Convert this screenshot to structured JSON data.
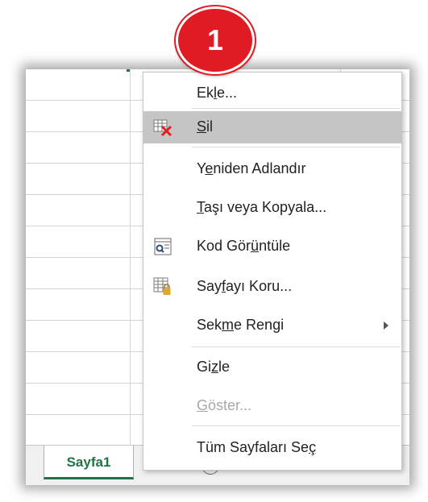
{
  "sheet_tab": {
    "label": "Sayfa1",
    "new_sheet_symbol": "+"
  },
  "callout": {
    "number": "1",
    "color": "#e01b23"
  },
  "menu": {
    "items": [
      {
        "pre": "Ek",
        "key": "l",
        "post": "e...",
        "icon": "",
        "disabled": false,
        "highlighted": false,
        "submenu": false
      },
      {
        "pre": "",
        "key": "S",
        "post": "il",
        "icon": "delete-sheet-icon",
        "disabled": false,
        "highlighted": true,
        "submenu": false
      },
      {
        "pre": "Y",
        "key": "e",
        "post": "niden Adlandır",
        "icon": "",
        "disabled": false,
        "highlighted": false,
        "submenu": false
      },
      {
        "pre": "",
        "key": "T",
        "post": "aşı veya Kopyala...",
        "icon": "",
        "disabled": false,
        "highlighted": false,
        "submenu": false
      },
      {
        "pre": "Kod Gör",
        "key": "ü",
        "post": "ntüle",
        "icon": "view-code-icon",
        "disabled": false,
        "highlighted": false,
        "submenu": false
      },
      {
        "pre": "Say",
        "key": "f",
        "post": "ayı Koru...",
        "icon": "protect-sheet-icon",
        "disabled": false,
        "highlighted": false,
        "submenu": false
      },
      {
        "pre": "Sek",
        "key": "m",
        "post": "e Rengi",
        "icon": "",
        "disabled": false,
        "highlighted": false,
        "submenu": true
      },
      {
        "pre": "Gi",
        "key": "z",
        "post": "le",
        "icon": "",
        "disabled": false,
        "highlighted": false,
        "submenu": false
      },
      {
        "pre": "",
        "key": "G",
        "post": "öster...",
        "icon": "",
        "disabled": true,
        "highlighted": false,
        "submenu": false
      },
      {
        "pre": "Tüm Sayfaları Se",
        "key": "ç",
        "post": "",
        "icon": "",
        "disabled": false,
        "highlighted": false,
        "submenu": false
      }
    ]
  },
  "colors": {
    "excel_green": "#217346",
    "highlight": "#c5c5c5",
    "disabled_text": "#a8a8a8"
  }
}
